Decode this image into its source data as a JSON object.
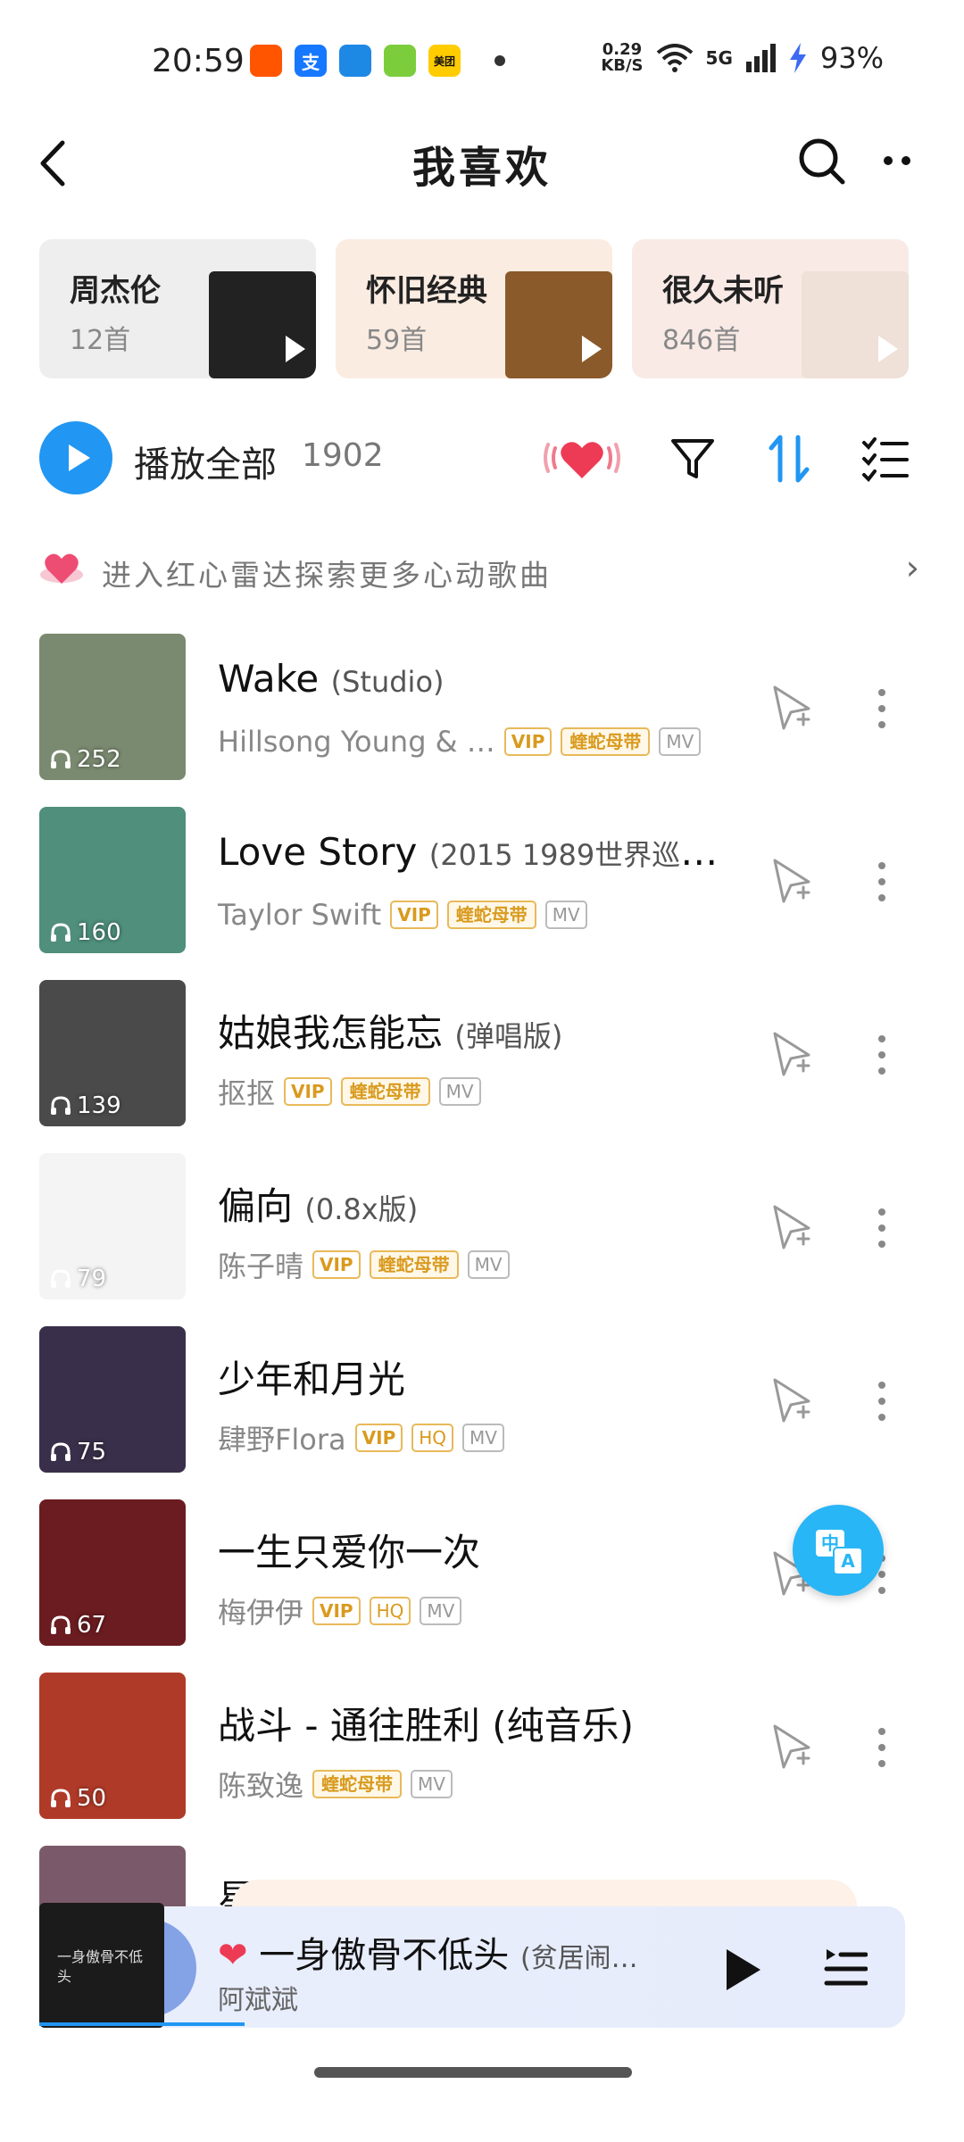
{
  "status_bar": {
    "time": "20:59",
    "app_icons": [
      {
        "icon": "taobao-icon",
        "label": "",
        "color": "#ff5500"
      },
      {
        "icon": "alipay-icon",
        "label": "支",
        "color": "#1677ff"
      },
      {
        "icon": "ai-app-icon",
        "label": "",
        "color": "#1e88e5"
      },
      {
        "icon": "green-app-icon",
        "label": "",
        "color": "#7ccd3c"
      },
      {
        "icon": "meituan-icon",
        "label": "美团",
        "color": "#ffcc00"
      }
    ],
    "net_speed_value": "0.29",
    "net_speed_unit": "KB/S",
    "network": "5G",
    "battery": "93%"
  },
  "header": {
    "title": "我喜欢"
  },
  "playlists": [
    {
      "title": "周杰伦",
      "count": "12首",
      "bg": "#eeeeee",
      "cover": "#222222"
    },
    {
      "title": "怀旧经典",
      "count": "59首",
      "bg": "#fbece2",
      "cover": "#8a5a2a"
    },
    {
      "title": "很久未听",
      "count": "846首",
      "bg": "#f9eae6",
      "cover": "#efe0d8"
    }
  ],
  "play_all": {
    "label": "播放全部",
    "count": "1902"
  },
  "radar": {
    "text": "进入红心雷达探索更多心动歌曲",
    "arrow": "›"
  },
  "songs": [
    {
      "title": "Wake",
      "subtitle": "(Studio)",
      "artist": "Hillsong Young & …",
      "plays": "252",
      "tags": [
        "VIP",
        "蝰蛇母带",
        "MV"
      ],
      "cover": "#7a8a70"
    },
    {
      "title": "Love Story",
      "subtitle": "(2015 1989世界巡回…",
      "artist": "Taylor Swift",
      "plays": "160",
      "tags": [
        "VIP",
        "蝰蛇母带",
        "MV"
      ],
      "cover": "#4f8f7c"
    },
    {
      "title": "姑娘我怎能忘",
      "subtitle": "(弹唱版)",
      "artist": "抠抠",
      "plays": "139",
      "tags": [
        "VIP",
        "蝰蛇母带",
        "MV"
      ],
      "cover": "#4a4a4a"
    },
    {
      "title": "偏向",
      "subtitle": "(0.8x版)",
      "artist": "陈子晴",
      "plays": "79",
      "tags": [
        "VIP",
        "蝰蛇母带",
        "MV"
      ],
      "cover": "#f4f4f4"
    },
    {
      "title": "少年和月光",
      "subtitle": "",
      "artist": "肆野Flora",
      "plays": "75",
      "tags": [
        "VIP",
        "HQ",
        "MV"
      ],
      "cover": "#3a2f4a"
    },
    {
      "title": "一生只爱你一次",
      "subtitle": "",
      "artist": "梅伊伊",
      "plays": "67",
      "tags": [
        "VIP",
        "HQ",
        "MV"
      ],
      "cover": "#6a1c20"
    },
    {
      "title": "战斗 - 通往胜利 (纯音乐)",
      "subtitle": "",
      "artist": "陈致逸",
      "plays": "50",
      "tags": [
        "蝰蛇母带",
        "MV"
      ],
      "cover": "#b03a28"
    }
  ],
  "partial_song": {
    "title": "星辰大海",
    "cover": "#7a5a6a"
  },
  "mini_player": {
    "title": "一身傲骨不低头",
    "subtitle": "(贫居闹…",
    "artist": "阿斌斌",
    "cover_text": "一身傲骨不低头"
  },
  "colors": {
    "accent": "#2196f3",
    "vip_gold": "#d99a1e",
    "heart": "#ee3b55"
  }
}
